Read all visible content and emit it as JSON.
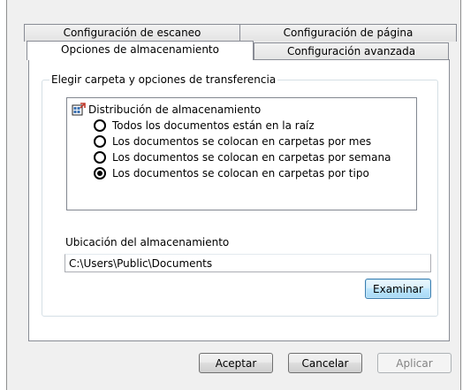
{
  "tabs": {
    "row1": [
      "Configuración de escaneo",
      "Configuración de página"
    ],
    "row2": [
      "Opciones de almacenamiento",
      "Configuración avanzada"
    ],
    "active": "Opciones de almacenamiento"
  },
  "group": {
    "legend": "Elegir carpeta y opciones de transferencia",
    "tree_root": "Distribución de almacenamiento",
    "options": [
      {
        "label": "Todos los documentos están en la raíz",
        "checked": false
      },
      {
        "label": "Los documentos se colocan en carpetas por mes",
        "checked": false
      },
      {
        "label": "Los documentos se colocan en carpetas por semana",
        "checked": false
      },
      {
        "label": "Los documentos se colocan en carpetas por tipo",
        "checked": true
      }
    ],
    "location_label": "Ubicación del almacenamiento",
    "location_value": "C:\\Users\\Public\\Documents",
    "browse_label": "Examinar"
  },
  "buttons": {
    "ok": "Aceptar",
    "cancel": "Cancelar",
    "apply": "Aplicar"
  }
}
